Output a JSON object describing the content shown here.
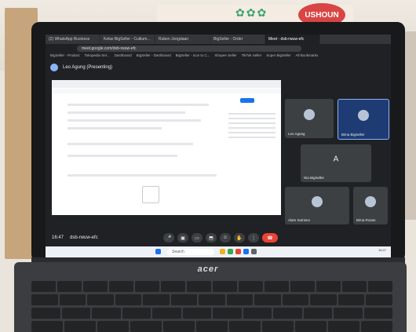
{
  "browser": {
    "tabs": [
      {
        "label": "(2) WhatsApp Business"
      },
      {
        "label": "Kelas BigSeller - Cuitium..."
      },
      {
        "label": "Ruben Jongdaan"
      },
      {
        "label": "BigSeller - Order"
      },
      {
        "label": "Meet - dsb-rwuw-efc",
        "active": true
      }
    ],
    "url": "meet.google.com/dsb-rwuw-efc",
    "bookmarks": [
      "BigSeller - Product",
      "Tokopedia Sel...",
      "Dashboard",
      "BigSeller - Dashboard",
      "BigSeller - Icon to C...",
      "Shopee Seller",
      "TikTok Seller",
      "Super BigSeller",
      "All Bookmarks"
    ]
  },
  "meet": {
    "presenter_label": "Leo Agung (Presenting)",
    "tiles": [
      {
        "name": "Leo Agung",
        "type": "photo",
        "highlight": false
      },
      {
        "name": "Bima BigSeller",
        "type": "photo",
        "highlight": true
      },
      {
        "name": "Nia BigSeller",
        "type": "letter",
        "letter": "A",
        "highlight": false
      },
      {
        "name": "Alam Sutrisno",
        "type": "photo",
        "highlight": false
      },
      {
        "name": "Bima Rosan",
        "type": "photo",
        "highlight": false
      }
    ],
    "time": "16:47",
    "meeting_code": "dsb-rwuw-efc",
    "controls": [
      "mic",
      "camera",
      "captions",
      "present",
      "reactions",
      "raise-hand",
      "more",
      "end-call"
    ]
  },
  "taskbar": {
    "search_placeholder": "Search",
    "clock": "16:47"
  },
  "laptop": {
    "brand": "acer"
  },
  "decor": {
    "poster_text": "USHOUN"
  },
  "colors": {
    "meet_bg": "#202124",
    "tile_bg": "#3c4043",
    "end_call": "#ea4335",
    "accent": "#1a73e8"
  }
}
